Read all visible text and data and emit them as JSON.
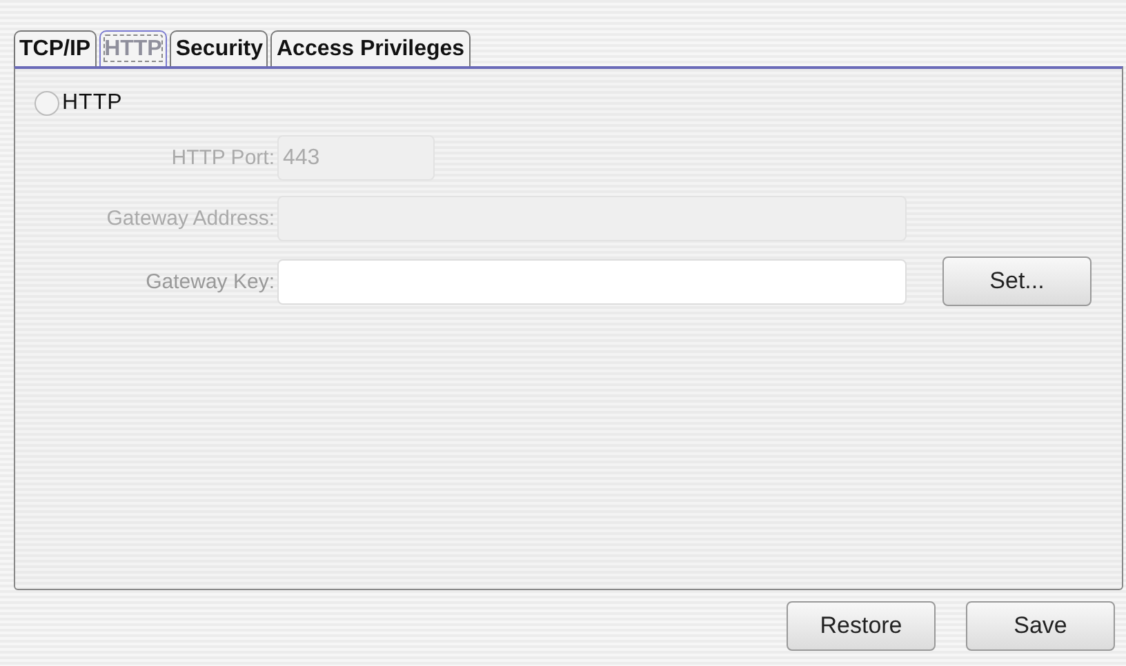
{
  "tabs": [
    {
      "label": "TCP/IP",
      "selected": false
    },
    {
      "label": "HTTP",
      "selected": true
    },
    {
      "label": "Security",
      "selected": false
    },
    {
      "label": "Access Privileges",
      "selected": false
    }
  ],
  "http_option": {
    "label": "HTTP",
    "checked": false
  },
  "fields": [
    {
      "label": "HTTP Port:",
      "value": "443",
      "disabled": true
    },
    {
      "label": "Gateway Address:",
      "disabled": true
    },
    {
      "label": "Gateway Key:",
      "disabled": false,
      "button": "Set..."
    }
  ],
  "buttons": [
    "Restore",
    "Save"
  ]
}
